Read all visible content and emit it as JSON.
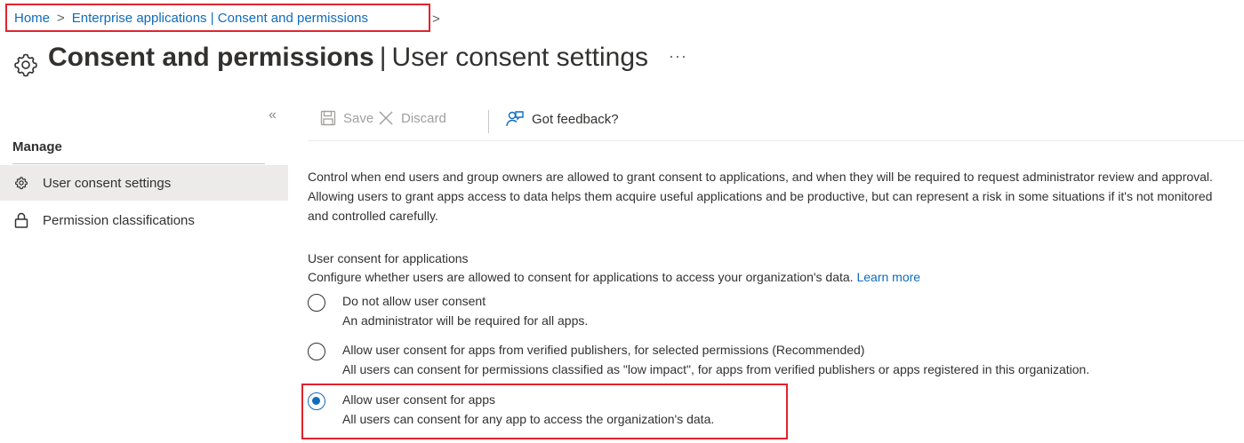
{
  "breadcrumb": {
    "home": "Home",
    "parent": "Enterprise applications | Consent and permissions",
    "separator": ">",
    "trailing": ">"
  },
  "header": {
    "title_bold": "Consent and permissions",
    "title_separator": "|",
    "title_rest": "User consent settings",
    "more": "···",
    "icon": "gear-icon"
  },
  "sidebar": {
    "collapse": "«",
    "heading": "Manage",
    "items": [
      {
        "label": "User consent settings",
        "icon": "gear-icon",
        "selected": true
      },
      {
        "label": "Permission classifications",
        "icon": "lock-icon",
        "selected": false
      }
    ]
  },
  "toolbar": {
    "save_label": "Save",
    "discard_label": "Discard",
    "feedback_label": "Got feedback?"
  },
  "main": {
    "intro": "Control when end users and group owners are allowed to grant consent to applications, and when they will be required to request administrator review and approval. Allowing users to grant apps access to data helps them acquire useful applications and be productive, but can represent a risk in some situations if it's not monitored and controlled carefully.",
    "section_heading": "User consent for applications",
    "section_desc": "Configure whether users are allowed to consent for applications to access your organization's data.",
    "learn_more": "Learn more",
    "options": [
      {
        "label": "Do not allow user consent",
        "description": "An administrator will be required for all apps.",
        "selected": false
      },
      {
        "label": "Allow user consent for apps from verified publishers, for selected permissions (Recommended)",
        "description": "All users can consent for permissions classified as \"low impact\", for apps from verified publishers or apps registered in this organization.",
        "selected": false
      },
      {
        "label": "Allow user consent for apps",
        "description": "All users can consent for any app to access the organization's data.",
        "selected": true
      }
    ]
  },
  "colors": {
    "accent": "#0f6cbd",
    "highlight": "#e0242e",
    "selected_bg": "#edebe9",
    "disabled_text": "#a19f9d"
  }
}
